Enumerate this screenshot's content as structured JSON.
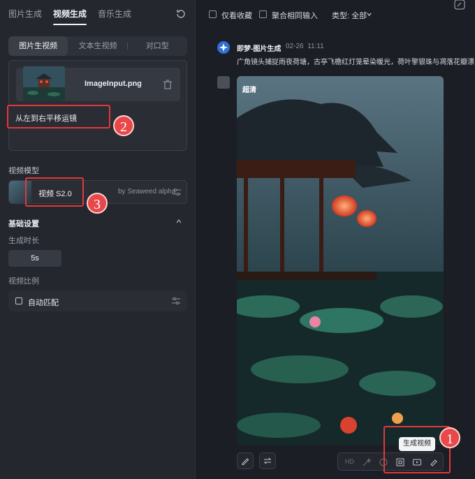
{
  "left": {
    "tabs": [
      "图片生成",
      "视频生成",
      "音乐生成"
    ],
    "subtabs": [
      "图片生视频",
      "文本生视频",
      "对口型"
    ],
    "upload": {
      "filename": "ImageInput.png"
    },
    "prompt_text": "从左到右平移运镜",
    "model_section_label": "视频模型",
    "model_name": "视频 S2.0",
    "model_provider": "by Seaweed alpha",
    "basic_settings_label": "基础设置",
    "duration_label": "生成时长",
    "duration_value": "5s",
    "ratio_label": "视频比例",
    "ratio_value": "自动匹配"
  },
  "right": {
    "filters": [
      "仅看收藏",
      "聚合相同输入"
    ],
    "type_filter": "类型: 全部",
    "sender": "即梦-图片生成",
    "date": "02-26",
    "time": "11:11",
    "message": "广角镜头捕捉雨夜荷塘，古亭飞檐红灯笼晕染暖光，荷叶擎银珠与凋落花瓣漂",
    "image_badge": "超清",
    "tooltip": "生成视频",
    "hd_label": "HD"
  },
  "annotations": [
    "1",
    "2",
    "3"
  ],
  "colors": {
    "accent_red": "#e3383b",
    "badge_red": "#e8484a",
    "bg": "#1b1e24",
    "panel": "#24272e"
  }
}
